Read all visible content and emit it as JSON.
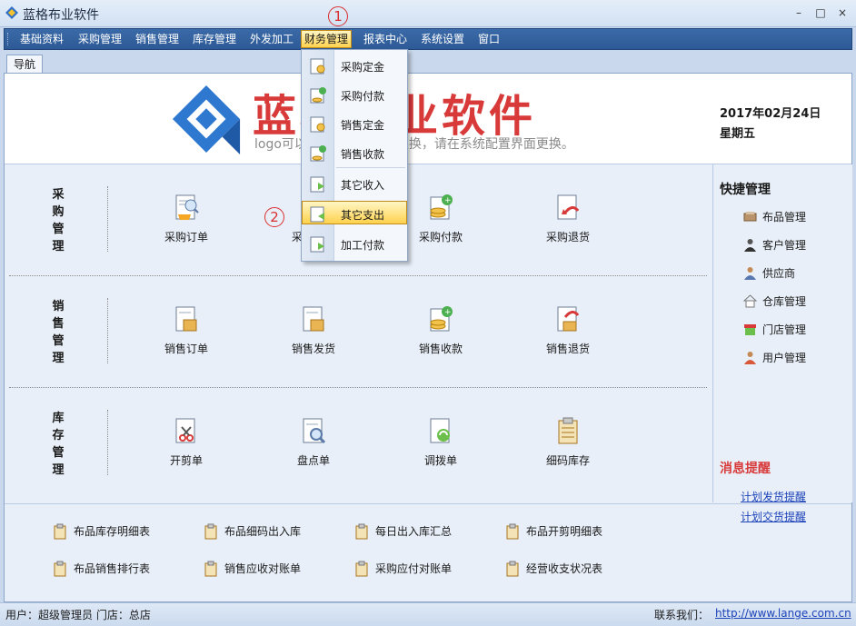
{
  "window": {
    "title": "蓝格布业软件",
    "minimize": "–",
    "restore": "□",
    "close": "×"
  },
  "menu": [
    {
      "label": "基础资料"
    },
    {
      "label": "采购管理"
    },
    {
      "label": "销售管理"
    },
    {
      "label": "库存管理"
    },
    {
      "label": "外发加工"
    },
    {
      "label": "财务管理",
      "active": true
    },
    {
      "label": "报表中心"
    },
    {
      "label": "系统设置"
    },
    {
      "label": "窗口"
    }
  ],
  "tab": {
    "label": "导航"
  },
  "header": {
    "logo_text": "蓝格布业软件",
    "logo_sub": "logo可以在系统配置界面更换，请在系统配置界面更换。",
    "date": "2017年02月24日",
    "weekday": "星期五"
  },
  "sections": [
    {
      "title": "采购管理",
      "items": [
        {
          "label": "采购订单",
          "icon": "purchase-order-icon"
        },
        {
          "label": "采购入库",
          "icon": "purchase-receive-icon"
        },
        {
          "label": "采购付款",
          "icon": "purchase-payment-icon"
        },
        {
          "label": "采购退货",
          "icon": "purchase-return-icon"
        }
      ]
    },
    {
      "title": "销售管理",
      "items": [
        {
          "label": "销售订单",
          "icon": "sales-order-icon"
        },
        {
          "label": "销售发货",
          "icon": "sales-delivery-icon"
        },
        {
          "label": "销售收款",
          "icon": "sales-receipt-icon"
        },
        {
          "label": "销售退货",
          "icon": "sales-return-icon"
        }
      ]
    },
    {
      "title": "库存管理",
      "items": [
        {
          "label": "开剪单",
          "icon": "cutting-order-icon"
        },
        {
          "label": "盘点单",
          "icon": "stocktake-icon"
        },
        {
          "label": "调拨单",
          "icon": "transfer-icon"
        },
        {
          "label": "细码库存",
          "icon": "detail-stock-icon"
        }
      ]
    }
  ],
  "quick": {
    "title": "快捷管理",
    "items": [
      {
        "label": "布品管理",
        "icon": "fabric-icon"
      },
      {
        "label": "客户管理",
        "icon": "customer-icon"
      },
      {
        "label": "供应商",
        "icon": "supplier-icon"
      },
      {
        "label": "仓库管理",
        "icon": "warehouse-icon"
      },
      {
        "label": "门店管理",
        "icon": "store-icon"
      },
      {
        "label": "用户管理",
        "icon": "user-icon"
      }
    ]
  },
  "messages": {
    "title": "消息提醒",
    "links": [
      {
        "label": "计划发货提醒"
      },
      {
        "label": "计划交货提醒"
      }
    ]
  },
  "reports": [
    {
      "label": "布品库存明细表"
    },
    {
      "label": "布品细码出入库"
    },
    {
      "label": "每日出入库汇总"
    },
    {
      "label": "布品开剪明细表"
    },
    {
      "label": "布品销售排行表"
    },
    {
      "label": "销售应收对账单"
    },
    {
      "label": "采购应付对账单"
    },
    {
      "label": "经营收支状况表"
    }
  ],
  "status": {
    "user": "用户：超级管理员  门店：总店",
    "contact": "联系我们：",
    "url": "http://www.lange.com.cn"
  },
  "dropdown": [
    {
      "label": "采购定金",
      "icon": "purchase-deposit-icon"
    },
    {
      "label": "采购付款",
      "icon": "purchase-pay-icon"
    },
    {
      "label": "销售定金",
      "icon": "sales-deposit-icon"
    },
    {
      "label": "销售收款",
      "icon": "sales-collect-icon"
    },
    {
      "label": "其它收入",
      "icon": "other-income-icon"
    },
    {
      "label": "其它支出",
      "icon": "other-expense-icon",
      "highlight": true
    },
    {
      "label": "加工付款",
      "icon": "processing-pay-icon"
    }
  ],
  "callouts": [
    "1",
    "2"
  ],
  "colors": {
    "menubar": "#2d5a96",
    "accent_red": "#d83a3a",
    "highlight": "#ffd24e",
    "link": "#1d43b8"
  }
}
